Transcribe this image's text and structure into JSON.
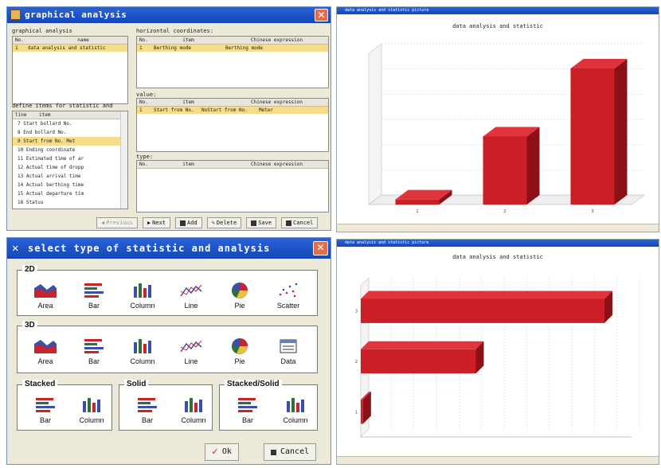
{
  "win1": {
    "title": "graphical analysis",
    "graphical_label": "graphical analysis",
    "graph_cols": [
      "No.",
      "name"
    ],
    "graph_rows": [
      [
        "1",
        "data analysis and statistic"
      ]
    ],
    "horiz_label": "horizontal coordinates:",
    "horiz_cols": [
      "No.",
      "item",
      "Chinese expression"
    ],
    "horiz_rows": [
      [
        "1",
        "Berthing mode",
        "Berthing mode"
      ]
    ],
    "value_label": "value:",
    "value_cols": [
      "No.",
      "item",
      "Chinese expression"
    ],
    "value_rows": [
      [
        "1",
        "Start from No.",
        "NoStart from No.",
        "Meter"
      ]
    ],
    "define_label": "define items for statistic and",
    "define_cols": [
      "line",
      "item"
    ],
    "define_items": [
      "7  Start bollard No.",
      "8  End bollard No.",
      "9  Start from No.  Met",
      "10  Ending coordinate",
      "11  Estimated time of ar",
      "12  Actual time of dropp",
      "13  Actual arrival time",
      "14  Actual berthing time",
      "15  Actual departure tim",
      "16  Status"
    ],
    "type_label": "type:",
    "type_cols": [
      "No.",
      "item",
      "Chinese expression"
    ],
    "buttons": {
      "previous": "Previous",
      "next": "Next",
      "add": "Add",
      "delete": "Delete",
      "save": "Save",
      "cancel": "Cancel"
    }
  },
  "dialog": {
    "title": "select type of statistic and analysis",
    "group_2d": "2D",
    "items_2d": [
      "Area",
      "Bar",
      "Column",
      "Line",
      "Pie",
      "Scatter"
    ],
    "group_3d": "3D",
    "items_3d": [
      "Area",
      "Bar",
      "Column",
      "Line",
      "Pie",
      "Data"
    ],
    "group_stacked": "Stacked",
    "items_stacked": [
      "Bar",
      "Column"
    ],
    "group_solid": "Solid",
    "items_solid": [
      "Bar",
      "Column"
    ],
    "group_stacked_solid": "Stacked/Solid",
    "items_stacked_solid": [
      "Bar",
      "Column"
    ],
    "ok": "Ok",
    "cancel": "Cancel"
  },
  "chart1": {
    "window_title": "data analysis and statistic picture",
    "title": "data analysis and statistic"
  },
  "chart2": {
    "window_title": "data analysis and statistic picture",
    "title": "data analysis and statistic"
  },
  "colors": {
    "bar_front": "#cc1e26",
    "bar_side": "#8c1016",
    "bar_top": "#e0343c",
    "title_blue": "#1446b8"
  },
  "chart_data": [
    {
      "type": "bar",
      "title": "data analysis and statistic",
      "categories": [
        "1",
        "2",
        "3"
      ],
      "values": [
        0.2,
        2.7,
        5.4
      ],
      "orientation": "vertical",
      "style": "3d",
      "ylim": [
        0,
        6
      ]
    },
    {
      "type": "bar",
      "title": "data analysis and statistic",
      "categories": [
        "1",
        "2",
        "3"
      ],
      "values": [
        0.1,
        5.1,
        10.8
      ],
      "orientation": "horizontal",
      "style": "3d",
      "xlim": [
        0,
        12
      ]
    }
  ]
}
